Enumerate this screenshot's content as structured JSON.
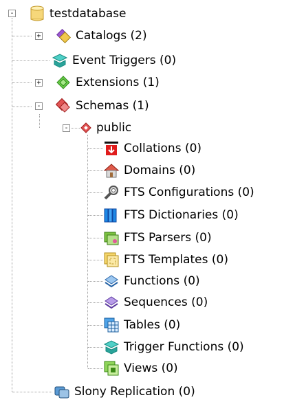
{
  "tree": {
    "root": {
      "label": "testdatabase",
      "icon": "database-icon",
      "expanded": true
    },
    "children": [
      {
        "label": "Catalogs (2)",
        "icon": "catalogs-icon",
        "expander": "+"
      },
      {
        "label": "Event Triggers (0)",
        "icon": "event-triggers-icon",
        "expander": ""
      },
      {
        "label": "Extensions (1)",
        "icon": "extensions-icon",
        "expander": "+"
      },
      {
        "label": "Schemas (1)",
        "icon": "schemas-icon",
        "expander": "-"
      },
      {
        "label": "Slony Replication (0)",
        "icon": "slony-replication-icon",
        "expander": ""
      }
    ],
    "schema": {
      "label": "public",
      "icon": "schema-public-icon",
      "expander": "-"
    },
    "schema_items": [
      {
        "label": "Collations (0)",
        "icon": "collations-icon"
      },
      {
        "label": "Domains (0)",
        "icon": "domains-icon"
      },
      {
        "label": "FTS Configurations (0)",
        "icon": "fts-configurations-icon"
      },
      {
        "label": "FTS Dictionaries (0)",
        "icon": "fts-dictionaries-icon"
      },
      {
        "label": "FTS Parsers (0)",
        "icon": "fts-parsers-icon"
      },
      {
        "label": "FTS Templates (0)",
        "icon": "fts-templates-icon"
      },
      {
        "label": "Functions (0)",
        "icon": "functions-icon"
      },
      {
        "label": "Sequences (0)",
        "icon": "sequences-icon"
      },
      {
        "label": "Tables (0)",
        "icon": "tables-icon"
      },
      {
        "label": "Trigger Functions (0)",
        "icon": "trigger-functions-icon"
      },
      {
        "label": "Views (0)",
        "icon": "views-icon"
      }
    ],
    "root_expander": "-"
  }
}
